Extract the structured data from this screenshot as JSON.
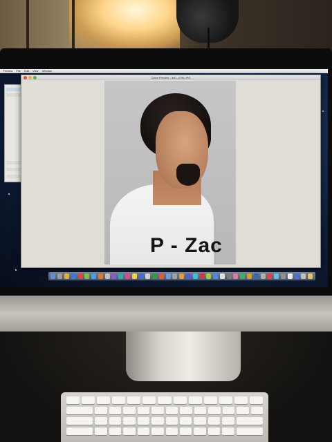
{
  "scene": {
    "description_colors": {
      "wall_light": "#ffd58a",
      "screen_bg": "#0f1f3b",
      "photo_bg": "#c6c6c8",
      "tshirt": "#f4f4f4"
    }
  },
  "menubar": {
    "items": [
      "Preview",
      "File",
      "Edit",
      "View",
      "Window"
    ]
  },
  "preview_window": {
    "title": "Quick Preview - IMG_4756.JPG"
  },
  "photo": {
    "shirt_text": "P - Zac"
  },
  "dock": {
    "icon_colors": [
      "#5f8fd8",
      "#9b9b9b",
      "#e0b040",
      "#3a7ad8",
      "#d84a3a",
      "#7ac04a",
      "#4aa0e0",
      "#e07a2a",
      "#c0c0c0",
      "#8a5ad0",
      "#2ab0a0",
      "#e04a8a",
      "#f0d040",
      "#4a6ad0",
      "#d0d0d0",
      "#3a9a3a",
      "#e05a3a",
      "#6aa0e0",
      "#a0a0a0",
      "#e0a040",
      "#5a5ad0",
      "#3ac0e0",
      "#d03a3a",
      "#9ad04a",
      "#4a8ae0",
      "#e0e0e0",
      "#7a7a7a",
      "#e07aa0",
      "#40b060",
      "#d0a030",
      "#3a6ab0",
      "#b0b0b0",
      "#e04040",
      "#60c0e0",
      "#909090",
      "#f0f0f0",
      "#5070d0",
      "#c0c0c0",
      "#e0c060"
    ]
  }
}
